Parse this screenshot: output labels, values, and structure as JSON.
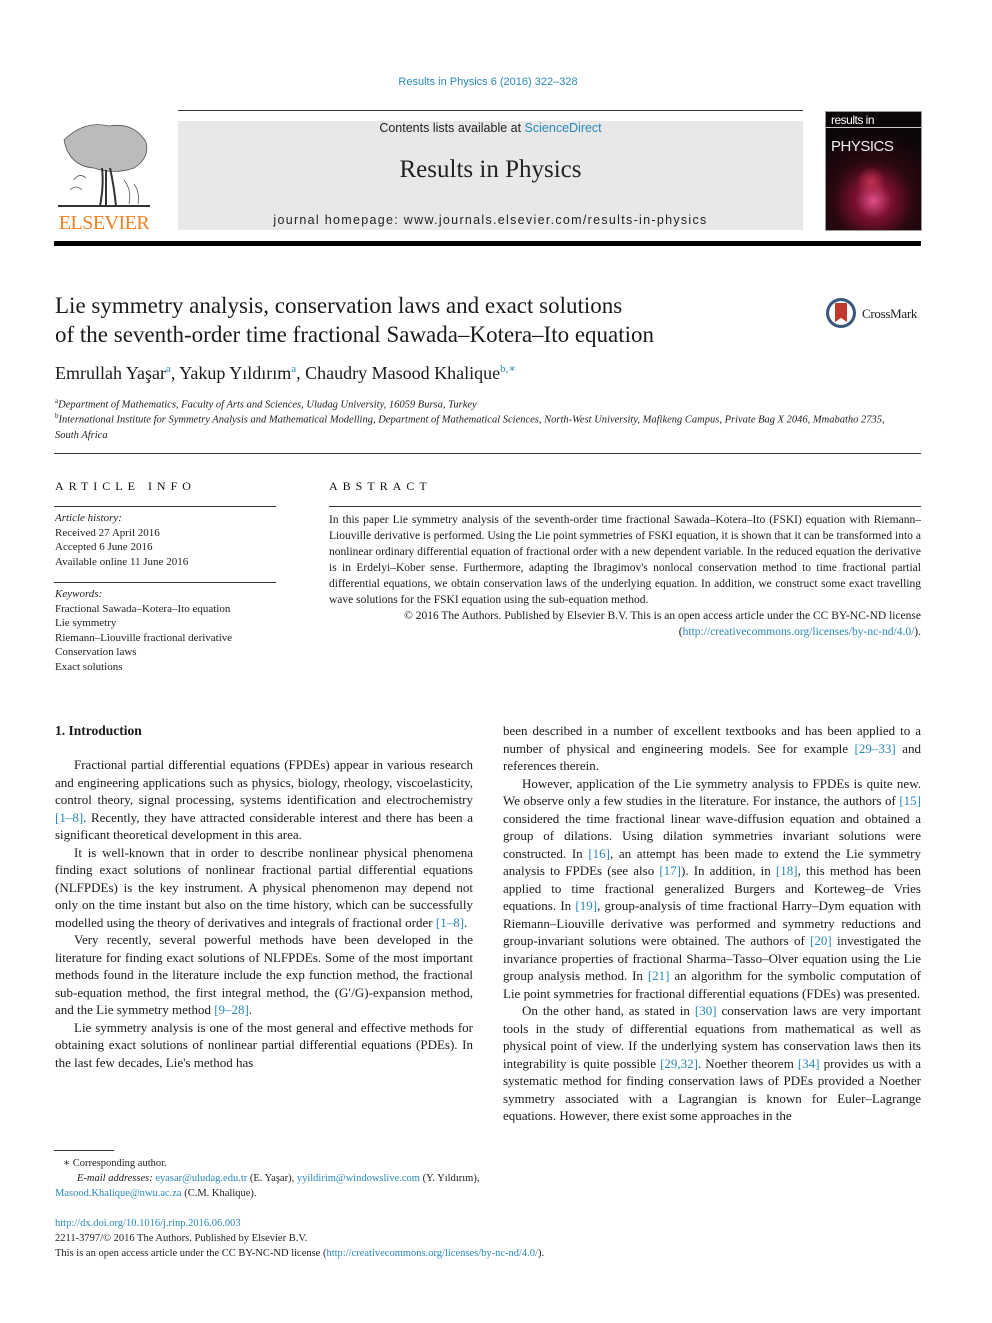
{
  "header": {
    "journal_ref": "Results in Physics 6 (2016) 322–328",
    "contents_prefix": "Contents lists available at ",
    "contents_link": "ScienceDirect",
    "journal_title": "Results in Physics",
    "homepage": "journal homepage: www.journals.elsevier.com/results-in-physics",
    "publisher_logo": "ELSEVIER",
    "cover_top": "results in",
    "cover_title": "PHYSICS",
    "crossmark_label": "CrossMark"
  },
  "article": {
    "title_line1": "Lie symmetry analysis, conservation laws and exact solutions",
    "title_line2": "of the seventh-order time fractional Sawada–Kotera–Ito equation",
    "authors": [
      {
        "name": "Emrullah Yaşar",
        "sup": "a"
      },
      {
        "name": "Yakup Yıldırım",
        "sup": "a"
      },
      {
        "name": "Chaudry Masood Khalique",
        "sup": "b,∗"
      }
    ],
    "affiliations": [
      {
        "sup": "a",
        "text": "Department of Mathematics, Faculty of Arts and Sciences, Uludag University, 16059 Bursa, Turkey"
      },
      {
        "sup": "b",
        "text": "International Institute for Symmetry Analysis and Mathematical Modelling, Department of Mathematical Sciences, North-West University, Mafikeng Campus, Private Bag X 2046, Mmabatho 2735, South Africa"
      }
    ]
  },
  "article_info": {
    "heading": "ARTICLE INFO",
    "history_label": "Article history:",
    "history": [
      "Received 27 April 2016",
      "Accepted 6 June 2016",
      "Available online 11 June 2016"
    ],
    "keywords_label": "Keywords:",
    "keywords": [
      "Fractional Sawada–Kotera–Ito equation",
      "Lie symmetry",
      "Riemann–Liouville fractional derivative",
      "Conservation laws",
      "Exact solutions"
    ]
  },
  "abstract": {
    "heading": "ABSTRACT",
    "text": "In this paper Lie symmetry analysis of the seventh-order time fractional Sawada–Kotera–Ito (FSKI) equation with Riemann–Liouville derivative is performed. Using the Lie point symmetries of FSKI equation, it is shown that it can be transformed into a nonlinear ordinary differential equation of fractional order with a new dependent variable. In the reduced equation the derivative is in Erdelyi–Kober sense. Furthermore, adapting the Ibragimov's nonlocal conservation method to time fractional partial differential equations, we obtain conservation laws of the underlying equation. In addition, we construct some exact travelling wave solutions for the FSKI equation using the sub-equation method.",
    "copyright": "© 2016 The Authors. Published by Elsevier B.V. This is an open access article under the CC BY-NC-ND",
    "license_prefix": "license (",
    "license_link": "http://creativecommons.org/licenses/by-nc-nd/4.0/",
    "license_suffix": ")."
  },
  "introduction": {
    "heading": "1. Introduction",
    "left_paragraphs": [
      [
        {
          "t": "Fractional partial differential equations (FPDEs) appear in various research and engineering applications such as physics, biology, rheology, viscoelasticity, control theory, signal processing, systems identification and electrochemistry "
        },
        {
          "t": "[1–8]",
          "link": true
        },
        {
          "t": ". Recently, they have attracted considerable interest and there has been a significant theoretical development in this area."
        }
      ],
      [
        {
          "t": "It is well-known that in order to describe nonlinear physical phenomena finding exact solutions of nonlinear fractional partial differential equations (NLFPDEs) is the key instrument. A physical phenomenon may depend not only on the time instant but also on the time history, which can be successfully modelled using the theory of derivatives and integrals of fractional order "
        },
        {
          "t": "[1–8]",
          "link": true
        },
        {
          "t": "."
        }
      ],
      [
        {
          "t": "Very recently, several powerful methods have been developed in the literature for finding exact solutions of NLFPDEs. Some of the most important methods found in the literature include the exp function method, the fractional sub-equation method, the first integral method, the (G′/G)-expansion method, and the Lie symmetry method "
        },
        {
          "t": "[9–28]",
          "link": true
        },
        {
          "t": "."
        }
      ],
      [
        {
          "t": "Lie symmetry analysis is one of the most general and effective methods for obtaining exact solutions of nonlinear partial differential equations (PDEs). In the last few decades, Lie's method has"
        }
      ]
    ],
    "right_paragraphs": [
      [
        {
          "t": "been described in a number of excellent textbooks and has been applied to a number of physical and engineering models. See for example "
        },
        {
          "t": "[29–33]",
          "link": true
        },
        {
          "t": " and references therein."
        }
      ],
      [
        {
          "t": "However, application of the Lie symmetry analysis to FPDEs is quite new. We observe only a few studies in the literature. For instance, the authors of "
        },
        {
          "t": "[15]",
          "link": true
        },
        {
          "t": " considered the time fractional linear wave-diffusion equation and obtained a group of dilations. Using dilation symmetries invariant solutions were constructed. In "
        },
        {
          "t": "[16]",
          "link": true
        },
        {
          "t": ", an attempt has been made to extend the Lie symmetry analysis to FPDEs (see also "
        },
        {
          "t": "[17]",
          "link": true
        },
        {
          "t": "). In addition, in "
        },
        {
          "t": "[18]",
          "link": true
        },
        {
          "t": ", this method has been applied to time fractional generalized Burgers and Korteweg–de Vries equations. In "
        },
        {
          "t": "[19]",
          "link": true
        },
        {
          "t": ", group-analysis of time fractional Harry–Dym equation with Riemann–Liouville derivative was performed and symmetry reductions and group-invariant solutions were obtained. The authors of "
        },
        {
          "t": "[20]",
          "link": true
        },
        {
          "t": " investigated the invariance properties of fractional Sharma–Tasso–Olver equation using the Lie group analysis method. In "
        },
        {
          "t": "[21]",
          "link": true
        },
        {
          "t": " an algorithm for the symbolic computation of Lie point symmetries for fractional differential equations (FDEs) was presented."
        }
      ],
      [
        {
          "t": "On the other hand, as stated in "
        },
        {
          "t": "[30]",
          "link": true
        },
        {
          "t": " conservation laws are very important tools in the study of differential equations from mathematical as well as physical point of view. If the underlying system has conservation laws then its integrability is quite possible "
        },
        {
          "t": "[29,32]",
          "link": true
        },
        {
          "t": ". Noether theorem "
        },
        {
          "t": "[34]",
          "link": true
        },
        {
          "t": " provides us with a systematic method for finding conservation laws of PDEs provided a Noether symmetry associated with a Lagrangian is known for Euler–Lagrange equations. However, there exist some approaches in the"
        }
      ]
    ]
  },
  "footnotes": {
    "corresponding": "∗ Corresponding author.",
    "email_label": "E-mail addresses: ",
    "emails": [
      {
        "addr": "eyasar@uludag.edu.tr",
        "who": " (E. Yaşar), "
      },
      {
        "addr": "yyildirim@windowslive.com",
        "who": " (Y. Yıldırım), "
      },
      {
        "addr": "Masood.Khalique@nwu.ac.za",
        "who": " (C.M. Khalique)."
      }
    ]
  },
  "bottom": {
    "doi": "http://dx.doi.org/10.1016/j.rinp.2016.06.003",
    "issn": "2211-3797/© 2016 The Authors. Published by Elsevier B.V.",
    "oa_prefix": "This is an open access article under the CC BY-NC-ND license (",
    "oa_link": "http://creativecommons.org/licenses/by-nc-nd/4.0/",
    "oa_suffix": ")."
  },
  "colors": {
    "link": "#2a88b8",
    "elsevier_orange": "#f08020",
    "header_gray": "#e8e8e8"
  }
}
